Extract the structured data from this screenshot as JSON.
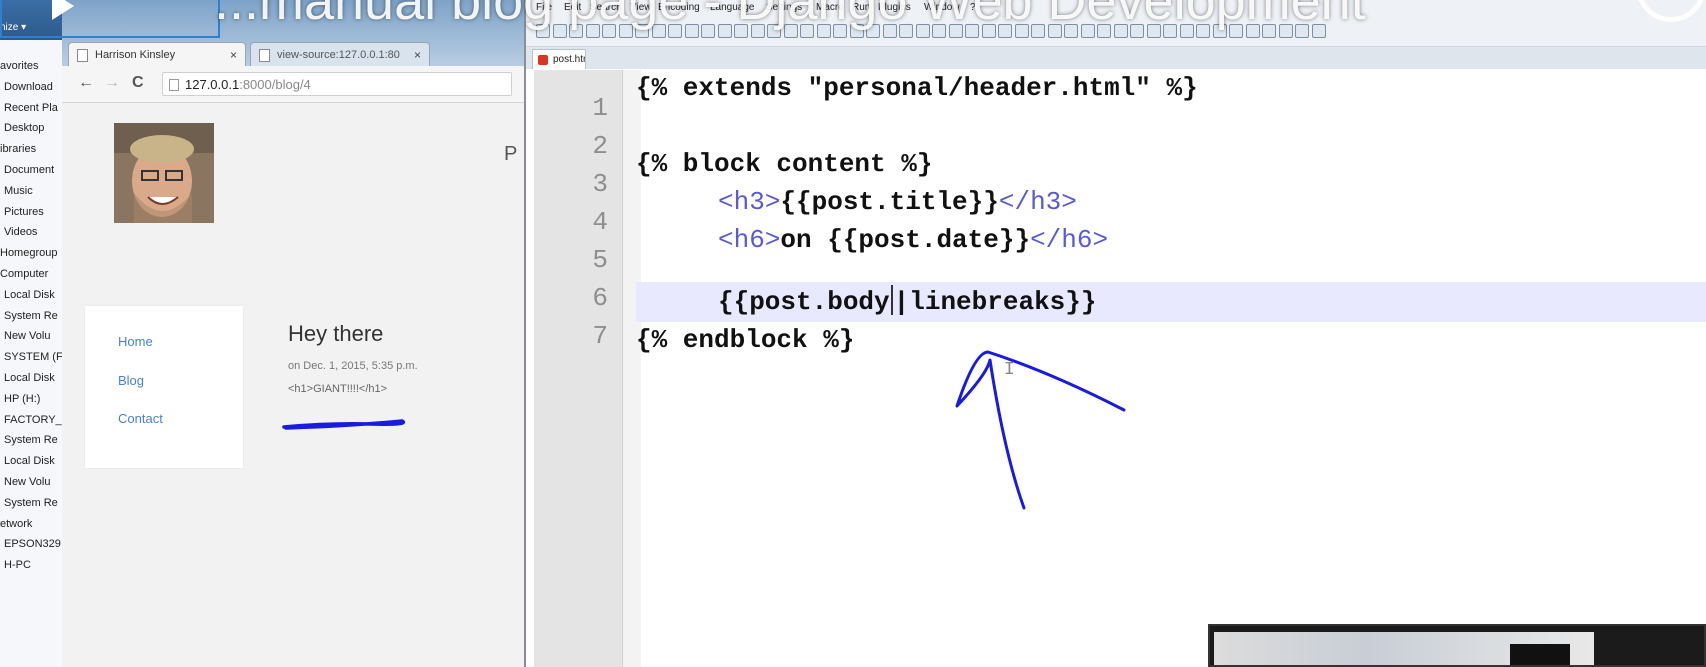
{
  "explorer": {
    "organize_label": "nize ▾",
    "items": [
      "avorites",
      "Download",
      "Recent Pla",
      "Desktop",
      "ibraries",
      "Document",
      "Music",
      "Pictures",
      "Videos",
      "Homegroup",
      "Computer",
      "Local Disk",
      "System Re",
      "New Volu",
      "SYSTEM (F",
      "Local Disk",
      "HP (H:)",
      "FACTORY_",
      "System Re",
      "Local Disk",
      "New Volu",
      "System Re",
      "etwork",
      "EPSON329",
      "H-PC"
    ]
  },
  "browser": {
    "tabs": [
      {
        "label": "Harrison Kinsley",
        "close": "×",
        "active": true
      },
      {
        "label": "view-source:127.0.0.1:80",
        "close": "×",
        "active": false
      }
    ],
    "nav": {
      "back": "←",
      "forward": "→",
      "reload": "C"
    },
    "address": {
      "host": "127.0.0.1",
      "path": ":8000/blog/4"
    },
    "page": {
      "stray_letter": "P",
      "nav_links": [
        "Home",
        "Blog",
        "Contact"
      ],
      "post_title": "Hey there",
      "post_date": "on Dec. 1, 2015, 5:35 p.m.",
      "post_body": "<h1>GIANT!!!!</h1>"
    }
  },
  "editor": {
    "menu": [
      "File",
      "Edit",
      "Search",
      "View",
      "Encoding",
      "Language",
      "Settings",
      "Macro",
      "Run",
      "Plugins",
      "Window",
      "?"
    ],
    "file_tab": "post.html",
    "line_numbers": [
      "1",
      "2",
      "3",
      "4",
      "5",
      "6",
      "7"
    ],
    "lines": [
      {
        "text": "{% extends \"personal/header.html\" %}"
      },
      {
        "text": ""
      },
      {
        "text": "{% block content %}"
      },
      {
        "open_tag": "<h3>",
        "text": "{{post.title}}",
        "close_tag": "</h3>"
      },
      {
        "open_tag": "<h6>",
        "text": "on {{post.date}}",
        "close_tag": "</h6>"
      },
      {
        "before_caret": "{{post.body",
        "after_caret": "|linebreaks}}"
      },
      {
        "text": "{% endblock %}"
      }
    ],
    "text_cursor": "I"
  },
  "overlay": {
    "video_title": "...manual blog page - Django Web Development"
  },
  "colors": {
    "annotation_ink": "#1a1ae0",
    "template_tag": "#5a5ad8",
    "link": "#4a7fd6",
    "current_line": "#e8e8ff"
  }
}
